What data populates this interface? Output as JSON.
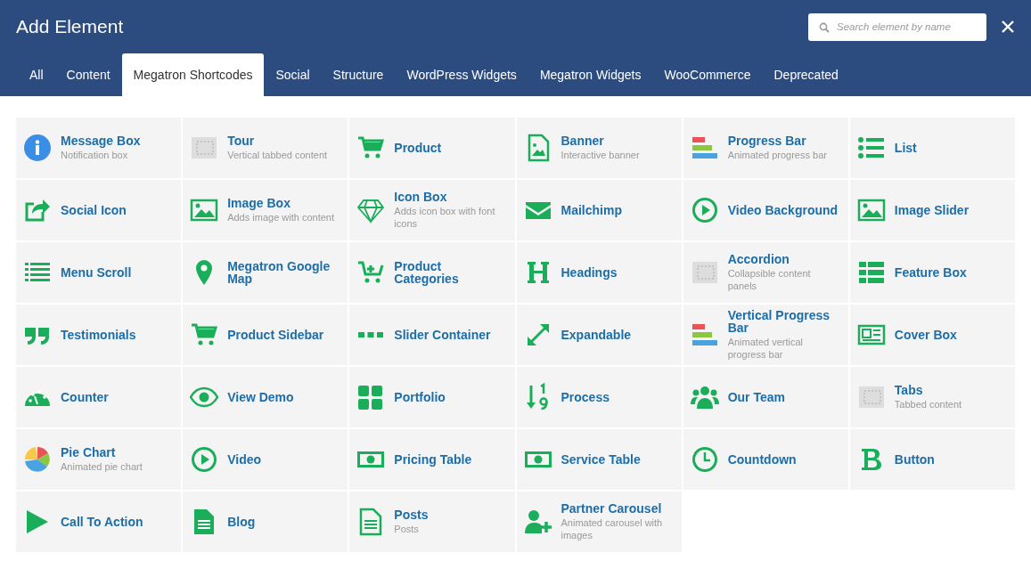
{
  "header": {
    "title": "Add Element"
  },
  "search": {
    "placeholder": "Search element by name"
  },
  "tabs": [
    {
      "label": "All",
      "selected": false
    },
    {
      "label": "Content",
      "selected": false
    },
    {
      "label": "Megatron Shortcodes",
      "selected": true
    },
    {
      "label": "Social",
      "selected": false
    },
    {
      "label": "Structure",
      "selected": false
    },
    {
      "label": "WordPress Widgets",
      "selected": false
    },
    {
      "label": "Megatron Widgets",
      "selected": false
    },
    {
      "label": "WooCommerce",
      "selected": false
    },
    {
      "label": "Deprecated",
      "selected": false
    }
  ],
  "elements": [
    {
      "title": "Message Box",
      "description": "Notification box"
    },
    {
      "title": "Tour",
      "description": "Vertical tabbed content"
    },
    {
      "title": "Product"
    },
    {
      "title": "Banner",
      "description": "Interactive banner"
    },
    {
      "title": "Progress Bar",
      "description": "Animated progress bar"
    },
    {
      "title": "List"
    },
    {
      "title": "Social Icon"
    },
    {
      "title": "Image Box",
      "description": "Adds image with content"
    },
    {
      "title": "Icon Box",
      "description": "Adds icon box with font icons"
    },
    {
      "title": "Mailchimp"
    },
    {
      "title": "Video Background"
    },
    {
      "title": "Image Slider"
    },
    {
      "title": "Menu Scroll"
    },
    {
      "title": "Megatron Google Map"
    },
    {
      "title": "Product Categories"
    },
    {
      "title": "Headings"
    },
    {
      "title": "Accordion",
      "description": "Collapsible content panels"
    },
    {
      "title": "Feature Box"
    },
    {
      "title": "Testimonials"
    },
    {
      "title": "Product Sidebar"
    },
    {
      "title": "Slider Container"
    },
    {
      "title": "Expandable"
    },
    {
      "title": "Vertical Progress Bar",
      "description": "Animated vertical progress bar"
    },
    {
      "title": "Cover Box"
    },
    {
      "title": "Counter"
    },
    {
      "title": "View Demo"
    },
    {
      "title": "Portfolio"
    },
    {
      "title": "Process"
    },
    {
      "title": "Our Team"
    },
    {
      "title": "Tabs",
      "description": "Tabbed content"
    },
    {
      "title": "Pie Chart",
      "description": "Animated pie chart"
    },
    {
      "title": "Video"
    },
    {
      "title": "Pricing Table"
    },
    {
      "title": "Service Table"
    },
    {
      "title": "Countdown"
    },
    {
      "title": "Button"
    },
    {
      "title": "Call To Action"
    },
    {
      "title": "Blog"
    },
    {
      "title": "Posts",
      "description": "Posts"
    },
    {
      "title": "Partner Carousel",
      "description": "Animated carousel with images"
    }
  ]
}
